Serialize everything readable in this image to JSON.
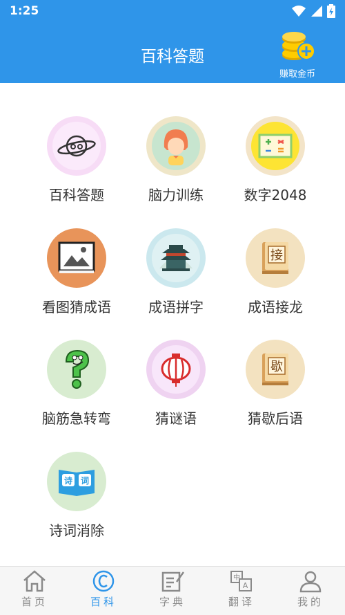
{
  "status": {
    "time": "1:25"
  },
  "header": {
    "title": "百科答题",
    "earn_label": "赚取金币"
  },
  "grid_items": [
    {
      "label": "百科答题",
      "icon": "planet-icon"
    },
    {
      "label": "脑力训练",
      "icon": "girl-avatar-icon"
    },
    {
      "label": "数字2048",
      "icon": "math-board-icon"
    },
    {
      "label": "看图猜成语",
      "icon": "picture-icon"
    },
    {
      "label": "成语拼字",
      "icon": "pavilion-icon"
    },
    {
      "label": "成语接龙",
      "icon": "book-jie-icon"
    },
    {
      "label": "脑筋急转弯",
      "icon": "question-mark-icon"
    },
    {
      "label": "猜谜语",
      "icon": "lantern-icon"
    },
    {
      "label": "猜歇后语",
      "icon": "book-xie-icon"
    },
    {
      "label": "诗词消除",
      "icon": "poem-book-icon"
    }
  ],
  "nav": [
    {
      "label": "首页",
      "icon": "home-icon"
    },
    {
      "label": "百科",
      "icon": "copyright-circle-icon",
      "active": true
    },
    {
      "label": "字典",
      "icon": "edit-note-icon"
    },
    {
      "label": "翻译",
      "icon": "translate-icon"
    },
    {
      "label": "我的",
      "icon": "user-icon"
    }
  ],
  "colors": {
    "primary": "#2f95e9",
    "nav_inactive": "#8a8a8a"
  }
}
